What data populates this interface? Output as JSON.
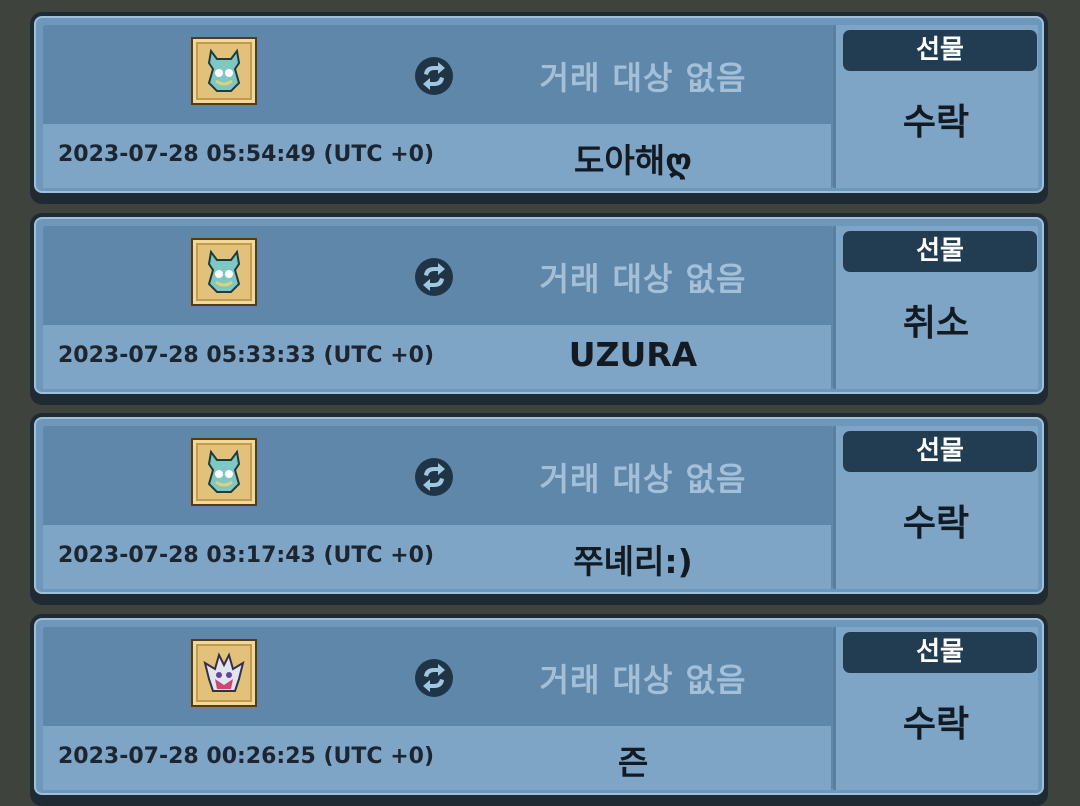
{
  "trades": [
    {
      "icon": "armor-item-icon",
      "trade_text": "거래 대상 없음",
      "date": "2023-07-28 05:54:49 (UTC +0)",
      "username": "도아해ღ",
      "type_label": "선물",
      "status": "수락"
    },
    {
      "icon": "armor-item-icon",
      "trade_text": "거래 대상 없음",
      "date": "2023-07-28 05:33:33 (UTC +0)",
      "username": "UZURA",
      "type_label": "선물",
      "status": "취소"
    },
    {
      "icon": "armor-item-icon",
      "trade_text": "거래 대상 없음",
      "date": "2023-07-28 03:17:43 (UTC +0)",
      "username": "쭈녜리:)",
      "type_label": "선물",
      "status": "수락"
    },
    {
      "icon": "helmet-item-icon",
      "trade_text": "거래 대상 없음",
      "date": "2023-07-28 00:26:25 (UTC +0)",
      "username": "즌",
      "type_label": "선물",
      "status": "수락"
    }
  ]
}
